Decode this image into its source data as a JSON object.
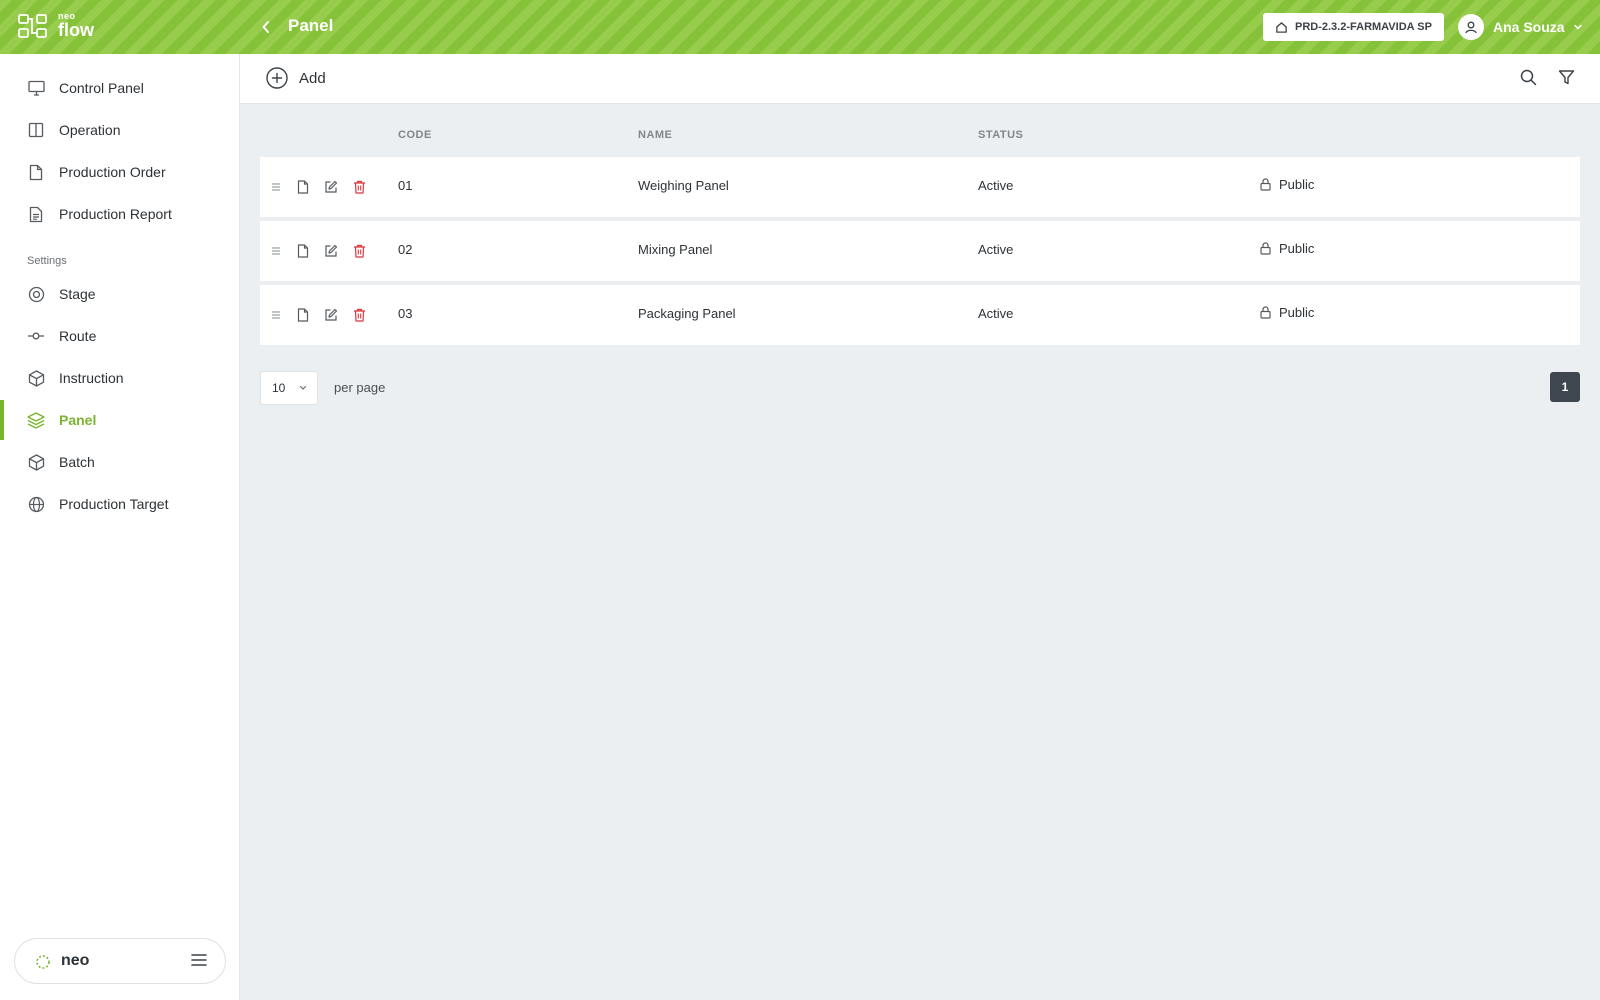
{
  "header": {
    "logo_small": "neo",
    "logo_large": "flow",
    "title": "Panel",
    "environment": "PRD-2.3.2-FARMAVIDA SP",
    "user_name": "Ana Souza"
  },
  "sidebar": {
    "items": [
      {
        "label": "Control Panel",
        "icon": "monitor-icon"
      },
      {
        "label": "Operation",
        "icon": "columns-icon"
      },
      {
        "label": "Production Order",
        "icon": "file-icon"
      },
      {
        "label": "Production Report",
        "icon": "file-text-icon"
      }
    ],
    "section_label": "Settings",
    "settings_items": [
      {
        "label": "Stage",
        "icon": "target-icon"
      },
      {
        "label": "Route",
        "icon": "route-icon"
      },
      {
        "label": "Instruction",
        "icon": "box-icon"
      },
      {
        "label": "Panel",
        "icon": "layers-icon",
        "active": true
      },
      {
        "label": "Batch",
        "icon": "box-icon"
      },
      {
        "label": "Production Target",
        "icon": "globe-icon"
      }
    ],
    "footer_brand": "neo"
  },
  "toolbar": {
    "add_label": "Add"
  },
  "table": {
    "columns": [
      "CODE",
      "NAME",
      "STATUS"
    ],
    "rows": [
      {
        "code": "01",
        "name": "Weighing Panel",
        "status": "Active",
        "visibility": "Public"
      },
      {
        "code": "02",
        "name": "Mixing Panel",
        "status": "Active",
        "visibility": "Public"
      },
      {
        "code": "03",
        "name": "Packaging Panel",
        "status": "Active",
        "visibility": "Public"
      }
    ]
  },
  "pagination": {
    "per_page_value": "10",
    "per_page_label": "per page",
    "current_page": "1"
  },
  "colors": {
    "brand_green": "#7bb52f",
    "delete_red": "#d9363e",
    "page_active": "#3e474f"
  }
}
